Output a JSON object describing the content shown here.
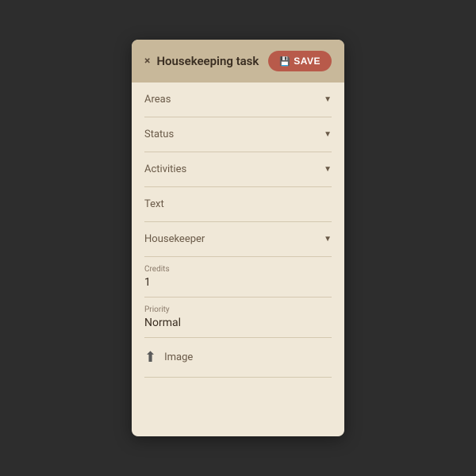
{
  "header": {
    "title": "Housekeeping task",
    "save_label": "SAVE",
    "close_icon": "×"
  },
  "fields": {
    "areas_label": "Areas",
    "status_label": "Status",
    "activities_label": "Activities",
    "text_label": "Text",
    "housekeeper_label": "Housekeeper",
    "credits_label": "Credits",
    "credits_value": "1",
    "priority_label": "Priority",
    "priority_value": "Normal",
    "image_label": "Image"
  },
  "colors": {
    "accent": "#b85a4a",
    "bg": "#f0e8d8",
    "header_bg": "#c8b89a"
  }
}
